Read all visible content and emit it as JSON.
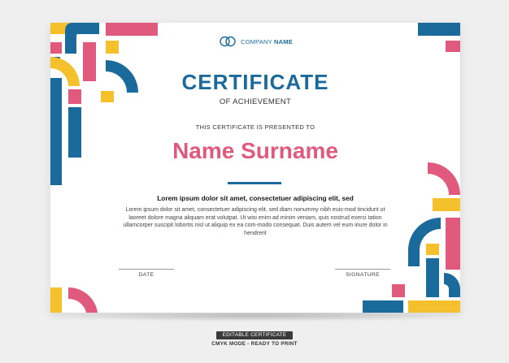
{
  "colors": {
    "blue": "#1b6a9c",
    "pink": "#e05a7e",
    "yellow": "#f4c02b",
    "gray": "#999999"
  },
  "logo": {
    "icon": "interlocking-rings-icon",
    "company_regular": "COMPANY",
    "company_bold": "NAME"
  },
  "certificate": {
    "title": "CERTIFICATE",
    "subtitle": "OF ACHIEVEMENT",
    "presented_to": "THIS CERTIFICATE IS PRESENTED TO",
    "recipient": "Name Surname",
    "lead": "Lorem ipsum dolor sit amet, consectetuer adipiscing elit, sed",
    "body": "Lorem ipsum dolor sit amet, consectetuer adipiscing elit, sed diam nonummy nibh euis-mod tincidunt ut laoreet dolore magna aliquam erat volutpat. Ut wisi enim ad minim veniam, quis nostrud exerci tation ullamcorper suscipit lobortis nisl ut aliquip ex ea com-modo consequat. Duis autem vel eum iriure dolor in hendrerit",
    "date_label": "DATE",
    "signature_label": "SIGNATURE"
  },
  "footer": {
    "badge": "EDITABLE CERTIFICATE",
    "mode": "CMYK MODE - READY TO PRINT"
  }
}
